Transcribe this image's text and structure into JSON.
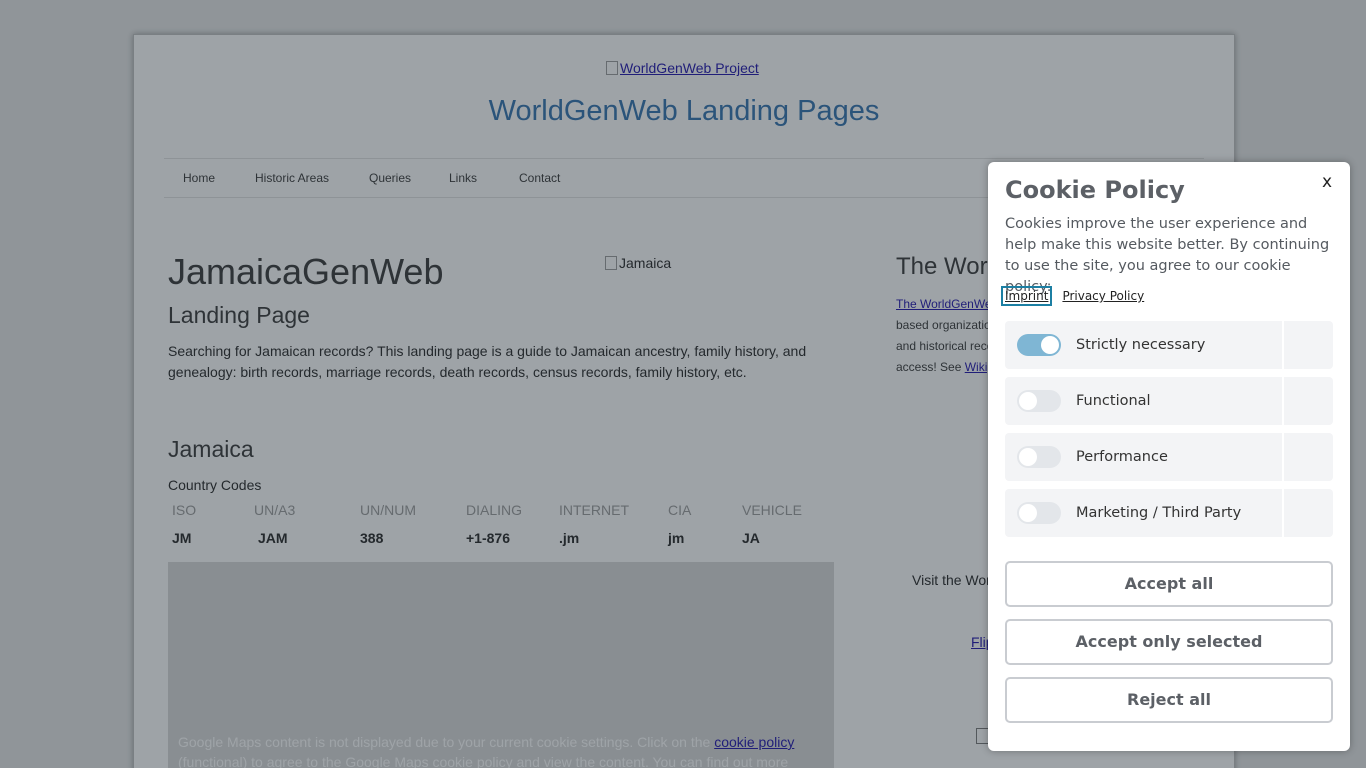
{
  "site": {
    "logo_alt": "WorldGenWeb Project",
    "title": "WorldGenWeb Landing Pages",
    "nav": [
      "Home",
      "Historic Areas",
      "Queries",
      "Links",
      "Contact"
    ]
  },
  "main": {
    "heading": "JamaicaGenWeb",
    "subheading": "Landing Page",
    "intro": "Searching for Jamaican records? This landing page is a guide to Jamaican ancestry, family history, and genealogy: birth records, marriage records, death records, census records, family history, etc.",
    "flag_alt": "Jamaica",
    "section_title": "Jamaica",
    "country_codes_label": "Country Codes",
    "codes_headers": [
      "ISO",
      "UN/A3",
      "UN/NUM",
      "DIALING",
      "INTERNET",
      "CIA",
      "VEHICLE"
    ],
    "codes_values": [
      "JM",
      "JAM",
      "388",
      "+1-876",
      ".jm",
      "jm",
      "JA"
    ],
    "map_notice_before": "Google Maps content is not displayed due to your current cookie settings. Click on the ",
    "map_notice_link": "cookie policy",
    "map_notice_after": " (functional) to agree to the Google Maps cookie policy and view the content. You can find out more"
  },
  "sidebar": {
    "title": "The Wor",
    "line1_link": "The WorldGenWe",
    "line2": "based organizatio",
    "line3": "and historical reco",
    "line4_text": "access! See ",
    "line4_link": "Wikip",
    "visit": "Visit the Wor",
    "flip": "Flip"
  },
  "cookie": {
    "title": "Cookie Policy",
    "close": "x",
    "description": "Cookies improve the user experience and help make this website better. By continuing to use the site, you agree to our cookie policy:",
    "imprint": "Imprint",
    "privacy": "Privacy Policy",
    "categories": [
      {
        "label": "Strictly necessary",
        "on": true
      },
      {
        "label": "Functional",
        "on": false
      },
      {
        "label": "Performance",
        "on": false
      },
      {
        "label": "Marketing / Third Party",
        "on": false
      }
    ],
    "accept_all": "Accept all",
    "accept_selected": "Accept only selected",
    "reject_all": "Reject all"
  }
}
